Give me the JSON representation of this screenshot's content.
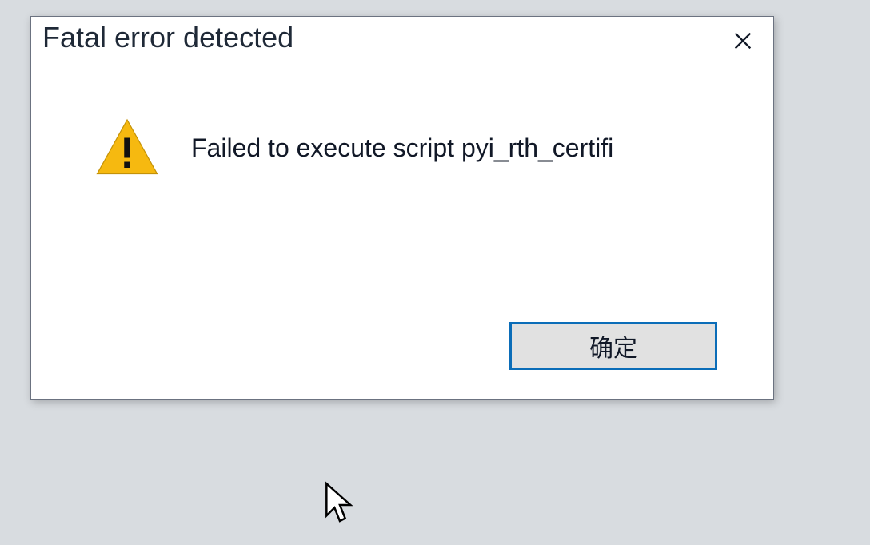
{
  "dialog": {
    "title": "Fatal error detected",
    "message": "Failed to execute script pyi_rth_certifi",
    "ok_label": "确定"
  }
}
